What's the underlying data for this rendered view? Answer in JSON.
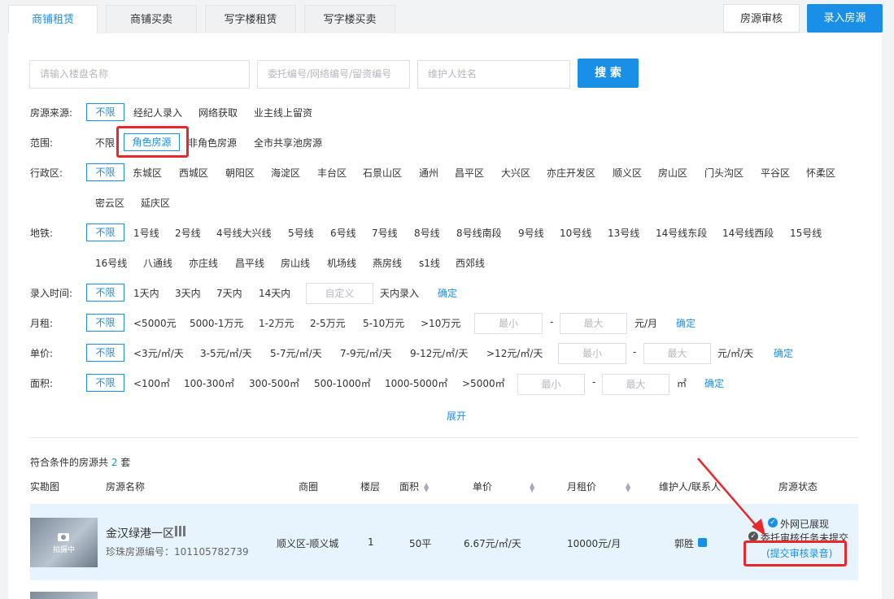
{
  "tabs": [
    "商铺租赁",
    "商铺买卖",
    "写字楼租赁",
    "写字楼买卖"
  ],
  "actions": {
    "review": "房源审核",
    "add": "录入房源"
  },
  "search": {
    "building_placeholder": "请输入楼盘名称",
    "code_placeholder": "委托编号/网络编号/留资编号",
    "maintainer_placeholder": "维护人姓名",
    "button": "搜 索"
  },
  "filters": {
    "source": {
      "label": "房源来源:",
      "options": [
        "不限",
        "经纪人录入",
        "网络获取",
        "业主线上留资"
      ]
    },
    "scope": {
      "label": "范围:",
      "options": [
        "不限",
        "角色房源",
        "非角色房源",
        "全市共享池房源"
      ]
    },
    "district": {
      "label": "行政区:",
      "options": [
        "不限",
        "东城区",
        "西城区",
        "朝阳区",
        "海淀区",
        "丰台区",
        "石景山区",
        "通州",
        "昌平区",
        "大兴区",
        "亦庄开发区",
        "顺义区",
        "房山区",
        "门头沟区",
        "平谷区",
        "怀柔区",
        "密云区",
        "延庆区"
      ]
    },
    "subway": {
      "label": "地铁:",
      "options": [
        "不限",
        "1号线",
        "2号线",
        "4号线大兴线",
        "5号线",
        "6号线",
        "7号线",
        "8号线",
        "8号线南段",
        "9号线",
        "10号线",
        "13号线",
        "14号线东段",
        "14号线西段",
        "15号线",
        "16号线",
        "八通线",
        "亦庄线",
        "昌平线",
        "房山线",
        "机场线",
        "燕房线",
        "s1线",
        "西郊线"
      ]
    },
    "time": {
      "label": "录入时间:",
      "options": [
        "不限",
        "1天内",
        "3天内",
        "7天内",
        "14天内"
      ],
      "custom_placeholder": "自定义",
      "suffix": "天内录入",
      "confirm": "确定"
    },
    "rent": {
      "label": "月租:",
      "options": [
        "不限",
        "<5000元",
        "5000-1万元",
        "1-2万元",
        "2-5万元",
        "5-10万元",
        ">10万元"
      ],
      "min": "最小",
      "dash": "-",
      "max": "最大",
      "unit": "元/月",
      "confirm": "确定"
    },
    "unit_price": {
      "label": "单价:",
      "options": [
        "不限",
        "<3元/㎡/天",
        "3-5元/㎡/天",
        "5-7元/㎡/天",
        "7-9元/㎡/天",
        "9-12元/㎡/天",
        ">12元/㎡/天"
      ],
      "min": "最小",
      "dash": "-",
      "max": "最大",
      "unit": "元/㎡/天",
      "confirm": "确定"
    },
    "area": {
      "label": "面积:",
      "options": [
        "不限",
        "<100㎡",
        "100-300㎡",
        "300-500㎡",
        "500-1000㎡",
        "1000-5000㎡",
        ">5000㎡"
      ],
      "min": "最小",
      "dash": "-",
      "max": "最大",
      "unit": "㎡",
      "confirm": "确定"
    },
    "expand": "展开"
  },
  "results": {
    "prefix": "符合条件的房源共",
    "count": "2",
    "suffix": "套",
    "columns": [
      "实勘图",
      "房源名称",
      "商圈",
      "楼层",
      "面积",
      "单价",
      "月租价",
      "维护人/联系人",
      "房源状态"
    ],
    "rows": [
      {
        "photo_label": "拍摄中",
        "name": "金汉绿港一区",
        "code": "珍珠房源编号：101105782739",
        "area_name": "顺义区-顺义城",
        "floor": "1",
        "size": "50平",
        "unit_price": "6.67元/㎡/天",
        "rent": "10000元/月",
        "maintainer": "郭胜",
        "status_online": "外网已展现",
        "status_task": "委托审核任务未提交",
        "status_action": "(提交审核录音)"
      }
    ]
  },
  "colors": {
    "accent": "#1a8fe8",
    "highlight": "#e8282a",
    "row_bg": "#e8f4fd"
  }
}
